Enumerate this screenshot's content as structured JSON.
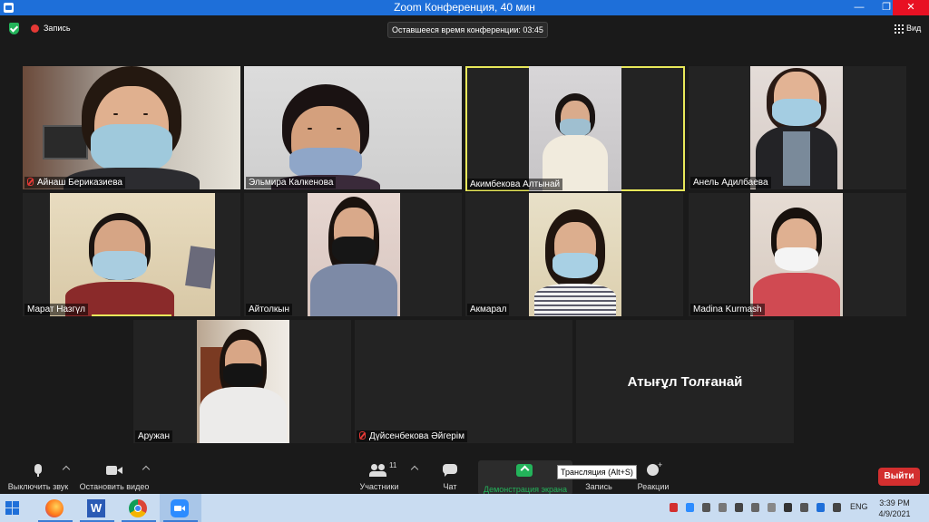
{
  "window": {
    "title": "Zoom Конференция, 40 мин",
    "minimize": "—",
    "maximize": "❐",
    "close": "✕"
  },
  "topbar": {
    "record_label": "Запись",
    "timer_text": "Оставшееся время конференции: 03:45",
    "view_label": "Вид"
  },
  "participants": [
    {
      "name": "Айнаш Бериказиева",
      "muted": true
    },
    {
      "name": "Эльмира Калкенова",
      "muted": false
    },
    {
      "name": "Акимбекова Алтынай",
      "muted": false,
      "active_speaker": true
    },
    {
      "name": "Анель Адилбаева",
      "muted": false
    },
    {
      "name": "Марат Назгүл",
      "muted": false
    },
    {
      "name": "Айтолкын",
      "muted": false
    },
    {
      "name": "Акмарал",
      "muted": false
    },
    {
      "name": "Madina Kurmash",
      "muted": false
    },
    {
      "name": "Аружан",
      "muted": false
    },
    {
      "name": "Дүйсенбекова Әйгерім",
      "muted": true
    },
    {
      "name": "Атығұл Толғанай",
      "muted": false,
      "video_off": true
    }
  ],
  "controls": {
    "mute_label": "Выключить звук",
    "video_label": "Остановить видео",
    "participants_label": "Участники",
    "participants_count": "11",
    "chat_label": "Чат",
    "share_label": "Демонстрация экрана",
    "record_label": "Запись",
    "reactions_label": "Реакции",
    "tooltip": "Трансляция (Alt+S)",
    "leave_label": "Выйти"
  },
  "taskbar": {
    "lang": "ENG",
    "time": "3:39 PM",
    "date": "4/9/2021",
    "apps": [
      "Firefox",
      "Word",
      "Chrome",
      "Zoom"
    ]
  },
  "colors": {
    "titlebar": "#1e6fd9",
    "active_speaker_border": "#e8e85a",
    "share_green": "#23b35a",
    "leave_red": "#d32f2f",
    "taskbar": "#c9dcf1"
  }
}
